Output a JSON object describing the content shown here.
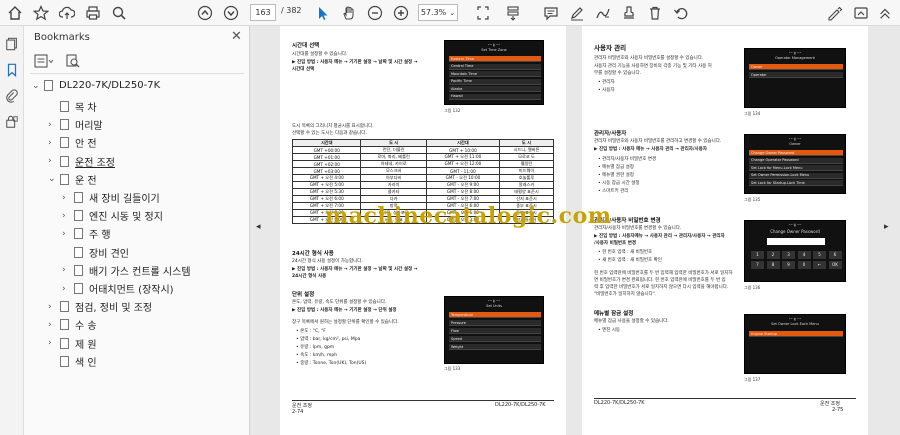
{
  "toolbar": {
    "page_current": "163",
    "page_total": "/ 382",
    "zoom": "57.3%"
  },
  "bookmarks": {
    "title": "Bookmarks",
    "root": "DL220-7K/DL250-7K",
    "items": [
      {
        "label": "목 차",
        "chev": ""
      },
      {
        "label": "머리말",
        "chev": "›"
      },
      {
        "label": "안 전",
        "chev": "›"
      },
      {
        "label": "운전 조정",
        "chev": "›"
      },
      {
        "label": "운 전",
        "chev": "⌄"
      },
      {
        "label": "새 장비 길들이기",
        "chev": "›"
      },
      {
        "label": "엔진 시동 및 정지",
        "chev": "›"
      },
      {
        "label": "주 행",
        "chev": "›"
      },
      {
        "label": "장비 견인",
        "chev": ""
      },
      {
        "label": "배기 가스 컨트롤 시스템",
        "chev": "›"
      },
      {
        "label": "어태치먼트 (장작시)",
        "chev": "›"
      },
      {
        "label": "점검, 정비 및 조정",
        "chev": "›"
      },
      {
        "label": "수 송",
        "chev": "›"
      },
      {
        "label": "제 원",
        "chev": "›"
      },
      {
        "label": "색 인",
        "chev": ""
      }
    ]
  },
  "left_page": {
    "h1": "시간대 선택",
    "p1": "시간대를 설정할 수 있습니다.",
    "nav1": "▶ 진입 방법 : 사용자 메뉴 → 기기판 설정 → 날짜 및 시간 설정 →",
    "nav1b": "시간대 선택",
    "screen1_title": "Set Time Zone",
    "screen1_rows": [
      "Eastern Time",
      "Central Time",
      "Mountain Time",
      "Pacific Time",
      "Alaska",
      "Hawaii"
    ],
    "fig1": "그림 132",
    "p2": "도시 목록의 그리니치 평균시를 표시합니다.",
    "p3": "선택할 수 있는 도시는 다음과 같습니다.",
    "table_head": [
      "시간대",
      "도 시",
      "시간대",
      "도 시"
    ],
    "table_rows": [
      [
        "GMT +00:00",
        "런던, 더블린",
        "GMT + 10:00",
        "시드니, 멜버른"
      ],
      [
        "GMT +01:00",
        "로마, 파리, 베를린",
        "GMT + 오전 11:00",
        "모로코 도"
      ],
      [
        "GMT +02:00",
        "아테네, 카이로",
        "GMT + 오전 12:00",
        "웰링턴"
      ],
      [
        "GMT +03:00",
        "모스크바",
        "GMT - 11:00",
        "미드웨이"
      ],
      [
        "GMT + 오전 4:00",
        "아부다비",
        "GMT - 오전 10:00",
        "호놀룰루"
      ],
      [
        "GMT + 오전 5:00",
        "카라치",
        "GMT - 오전 9:00",
        "알래스카"
      ],
      [
        "GMT + 오전 5:30",
        "콜카타",
        "GMT - 오전 8:00",
        "태평양 표준시"
      ],
      [
        "GMT + 오전 6:00",
        "다카",
        "GMT - 오전 7:00",
        "산지 표준시"
      ],
      [
        "GMT + 오전 7:00",
        "방콕",
        "GMT - 오전 6:00",
        "중부 표준시"
      ],
      [
        "GMT + 오전 8:00",
        "베이징, 싱가포르",
        "GMT - 오전 5:00",
        "동부 표준시"
      ],
      [
        "GMT + 오전 9:00",
        "서울, 도쿄",
        "GMT - 오전 3:00",
        "브라질리아"
      ]
    ],
    "h2": "24시간 형식 사용",
    "p4": "24시간 형식 사용 설정이 가능합니다.",
    "nav2": "▶ 진입 방법 : 사용자 메뉴 → 기기판 설정 → 날짜 및 시간 설정 →",
    "nav2b": "24시간 형식 사용",
    "h3": "단위 설정",
    "p5": "온도, 압력, 유량, 속도 단위를 설정할 수 있습니다.",
    "nav3": "▶ 진입 방법 : 사용자 메뉴 → 기기판 설정 → 단위 설정",
    "p6": "장구 목록에서 원하는 설정할 단위를 확인할 수 있습니다.",
    "units": [
      "• 온도 : °C, °F",
      "• 압력 : bar, kg/cm², psi, Mpa",
      "• 유량 : lpm, gpm",
      "• 속도 : km/h, mph",
      "• 중량 : Tonne, Ton(UK), Ton(US)"
    ],
    "screen2_title": "Set Units",
    "screen2_rows": [
      "Temperature",
      "Pressure",
      "Flow",
      "Speed",
      "Weight"
    ],
    "fig2": "그림 133",
    "foot_left": "운전 조정",
    "foot_page": "2-74",
    "foot_right": "DL220-7K/DL250-7K"
  },
  "right_page": {
    "h1": "사용자 관리",
    "p1": "관리자 비밀번호와 사용자 비밀번호를 설정할 수 있습니다.",
    "p2": "사용자 관리 기능을 사용하면 장비의 각종 기능 및 기타 사용 허",
    "p2b": "부를 설정할 수 있습니다.",
    "list1": [
      "• 관리자",
      "• 사용자"
    ],
    "screen1_title": "Operator Management",
    "screen1_rows": [
      "Owner",
      "Operator"
    ],
    "fig1": "그림 134",
    "h2": "관리자/사용자",
    "p3": "관리자 비밀번호와 사용자 비밀번호를 관리하고 변경할 수 있습니다.",
    "nav1": "▶ 진입 방법 : 사용자 메뉴 → 사용자 관리 → 관리자/사용자",
    "list2": [
      "• 관리자/사용자 비밀번호 변경",
      "• 메뉴별 잠금 설정",
      "• 메뉴별 권한 설정",
      "• 시동 잠금 시간 설정",
      "• 스마트키 관리"
    ],
    "screen2_title": "Owner",
    "screen2_rows": [
      "Change Owner Password",
      "Change Operator Password",
      "Set Lock for Menu-Lock Menu",
      "Set Owner Permission-Lock Menu",
      "Set Lock for Startup-Lock Time"
    ],
    "fig2": "그림 135",
    "h3": "관리자/사용자 비밀번호 변경",
    "p4": "관리자/사용자 비밀번호를 변경할 수 있습니다.",
    "nav2": "▶ 진입 방법 : 사용자메뉴 → 사용자 관리 → 관리자/사용자 → 관리자",
    "nav2b": "/사용자 비밀번호 변경",
    "list3": [
      "• 현 번호 입력 : 새 비밀번호",
      "• 새 번호 입력 : 새 비밀번호 확인"
    ],
    "p5": "현 번호 입력란에 비밀번호를 두 번 입력해 입력한 비밀번호가 서로 일치하",
    "p5b": "면 비밀번호가 변경 완료됩니다. 현 번호 입력란에 비밀번호를 두 번 입",
    "p5c": "력 후 입력한 비밀번호가 서로 일치하지 않으면 다시 입력을 해야합니다.",
    "p5d": "\"비밀번호가 일치하지 않습니다\".",
    "screen3_title": "Change Owner Password",
    "screen3_keys": [
      "1",
      "2",
      "3",
      "4",
      "5",
      "6",
      "7",
      "8",
      "9",
      "0",
      "←",
      "OK"
    ],
    "fig3": "그림 136",
    "h4": "메뉴별 잠금 설정",
    "p6": "메뉴별 잠금 사용을 설정할 수 있습니다.",
    "list4": [
      "• 엔진 시동"
    ],
    "screen4_title": "Set Owner Lock Each Menu",
    "screen4_rows": [
      "Engine Startup"
    ],
    "fig4": "그림 137",
    "foot_left": "DL220-7K/DL250-7K",
    "foot_right": "운전 조정",
    "foot_page": "2-75"
  },
  "watermark": "machinecatalogic.com"
}
